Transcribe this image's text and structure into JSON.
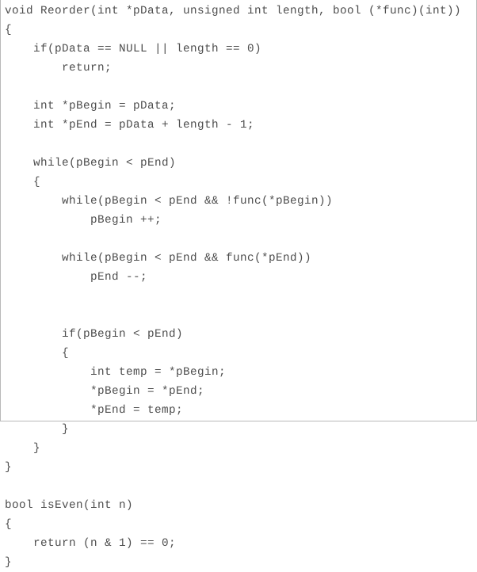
{
  "document": {
    "kind": "source-code-listing",
    "language": "C++",
    "background_color": "#ffffff",
    "text_color": "#4d4d4d",
    "border_color": "#b9b9b9",
    "indent_size": 4,
    "line_count": 32
  },
  "code": {
    "lines": [
      "void Reorder(int *pData, unsigned int length, bool (*func)(int))",
      "{",
      "    if(pData == NULL || length == 0)",
      "        return;",
      "",
      "    int *pBegin = pData;",
      "    int *pEnd = pData + length - 1;",
      "",
      "    while(pBegin < pEnd)",
      "    {",
      "        while(pBegin < pEnd && !func(*pBegin))",
      "            pBegin ++;",
      "",
      "        while(pBegin < pEnd && func(*pEnd))",
      "            pEnd --;",
      "",
      "",
      "        if(pBegin < pEnd)",
      "        {",
      "            int temp = *pBegin;",
      "            *pBegin = *pEnd;",
      "            *pEnd = temp;",
      "        }",
      "    }",
      "}",
      "",
      "bool isEven(int n)",
      "{",
      "    return (n & 1) == 0;",
      "}"
    ]
  }
}
